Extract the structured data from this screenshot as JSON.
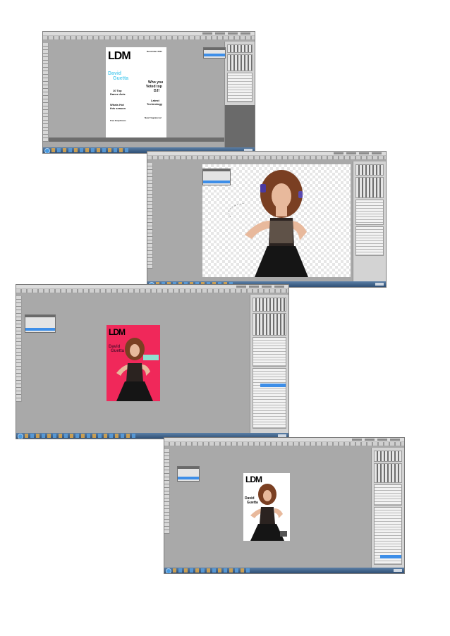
{
  "cover1": {
    "masthead": "LDM",
    "date": "December 2011",
    "headline_line1": "David",
    "headline_line2": "Guetta",
    "left_mid_1": "10 Top",
    "left_mid_2": "Dance Acts",
    "right_mid_1": "Who you",
    "right_mid_2": "Voted top",
    "right_mid_3": "DJ!",
    "left_low_1": "Whats Hot",
    "left_low_2": "this season",
    "right_low_1": "Latest",
    "right_low_2": "Technology",
    "left_foot": "Free Earphones",
    "right_foot": "New Fragrances!"
  },
  "cover3": {
    "masthead": "LDM",
    "headline_line1": "David",
    "headline_line2": "Guetta"
  },
  "cover4": {
    "masthead": "LDM",
    "headline_line1": "David",
    "headline_line2": "Guetta"
  },
  "colors": {
    "workspace": "#a9a9a9",
    "selection_blue": "#3d8ee8",
    "cyan_headline": "#5fd0f0",
    "pink_cover": "#f0285a"
  },
  "icons": [
    "photoshop-window",
    "layers-panel",
    "tools-panel",
    "windows-taskbar"
  ]
}
